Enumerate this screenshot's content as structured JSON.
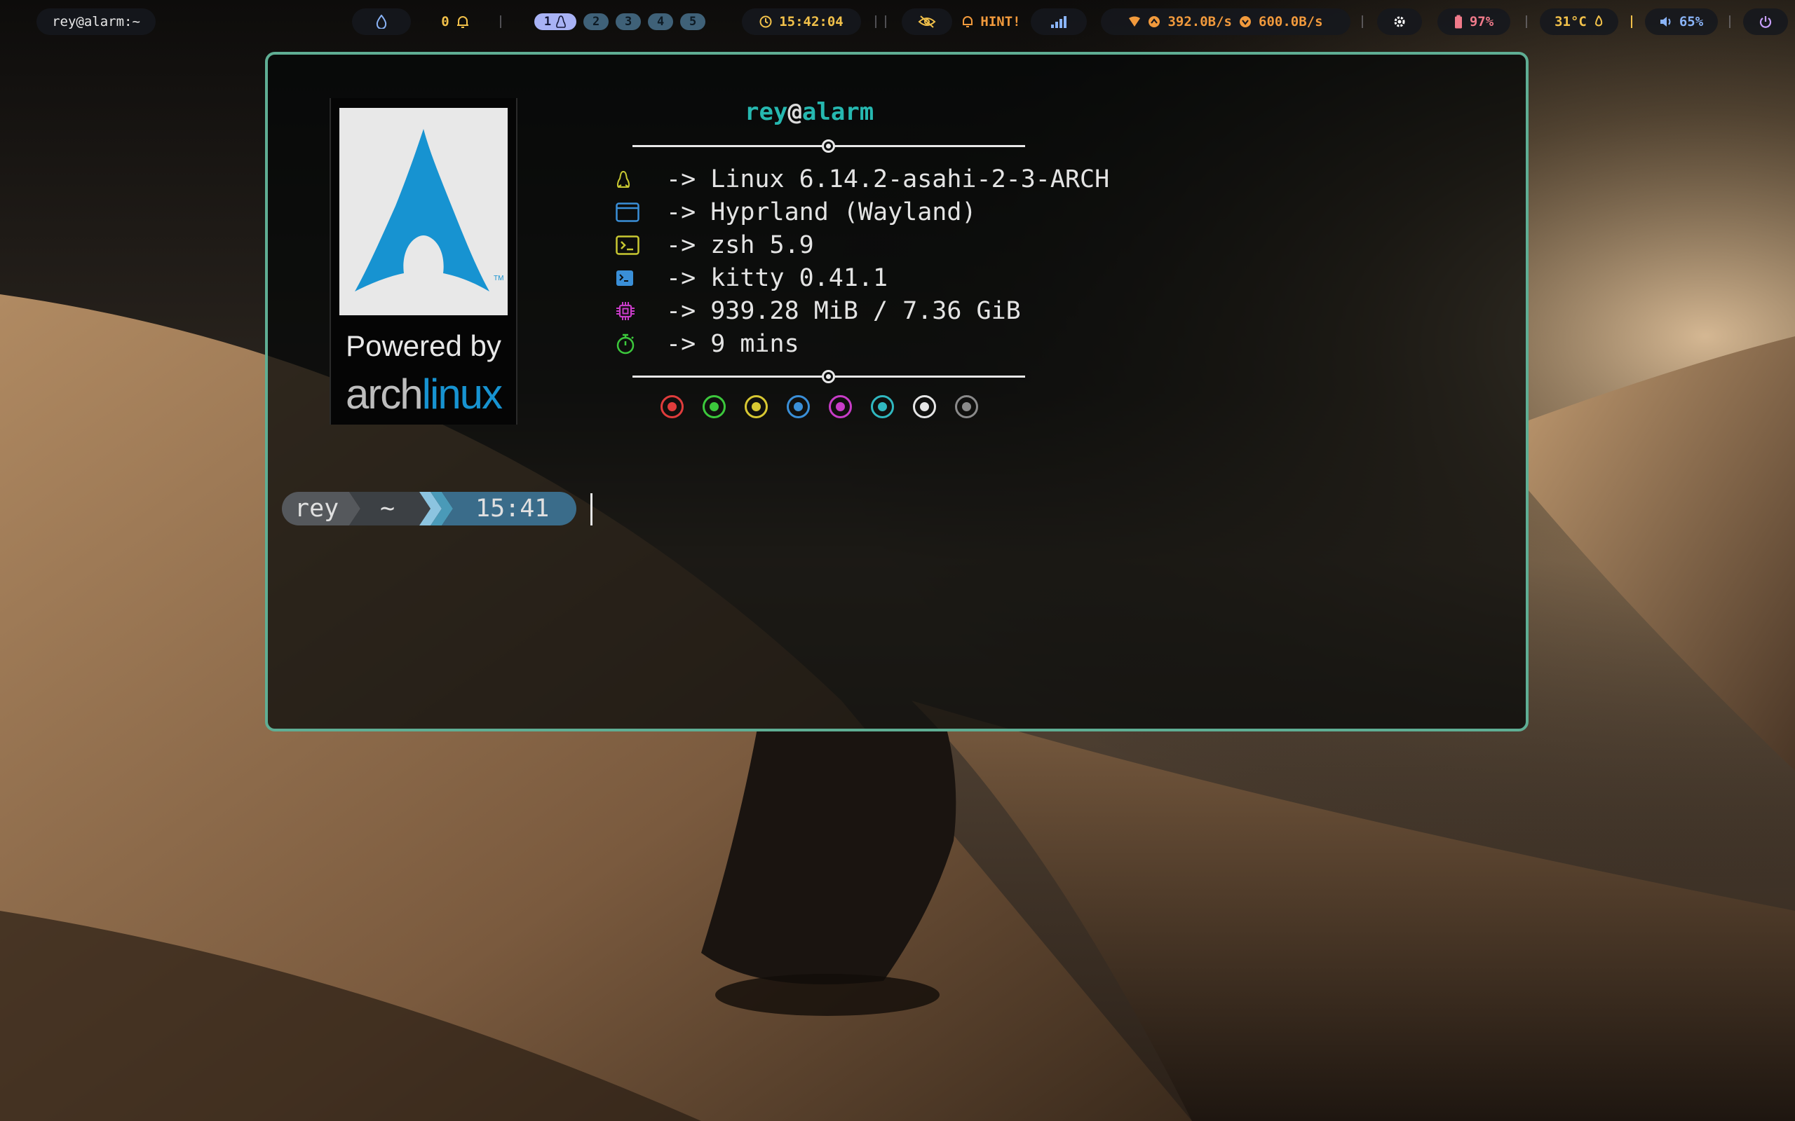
{
  "topbar": {
    "window_title": "rey@alarm:~",
    "notifications_count": "0",
    "workspaces": [
      "1",
      "2",
      "3",
      "4",
      "5"
    ],
    "active_workspace": "1",
    "clock": "15:42:04",
    "hint": "HINT!",
    "net_down": "392.0B/s",
    "net_up": "600.0B/s",
    "battery": "97%",
    "temperature": "31°C",
    "volume": "65%"
  },
  "terminal": {
    "user": "rey",
    "at": "@",
    "host": "alarm",
    "logo": {
      "powered_by": "Powered by",
      "brand_part1": "arch",
      "brand_part2": "linux"
    },
    "info": [
      {
        "icon": "linux-penguin-icon",
        "text": "-> Linux 6.14.2-asahi-2-3-ARCH",
        "color": "#c8c832"
      },
      {
        "icon": "window-icon",
        "text": "-> Hyprland (Wayland)",
        "color": "#3a8fd8"
      },
      {
        "icon": "shell-icon",
        "text": "-> zsh 5.9",
        "color": "#c8c832"
      },
      {
        "icon": "terminal-icon",
        "text": "-> kitty 0.41.1",
        "color": "#3a8fd8"
      },
      {
        "icon": "memory-chip-icon",
        "text": "-> 939.28 MiB / 7.36 GiB",
        "color": "#c83cc8"
      },
      {
        "icon": "stopwatch-icon",
        "text": "-> 9 mins",
        "color": "#3cc83c"
      }
    ],
    "palette": [
      "#e03c3c",
      "#3cc83c",
      "#d8c832",
      "#3a8fd8",
      "#c83cc8",
      "#30b8c0",
      "#e6e6e6",
      "#8a8a8a"
    ],
    "prompt": {
      "user": "rey",
      "dir": "~",
      "time": "15:41"
    }
  }
}
